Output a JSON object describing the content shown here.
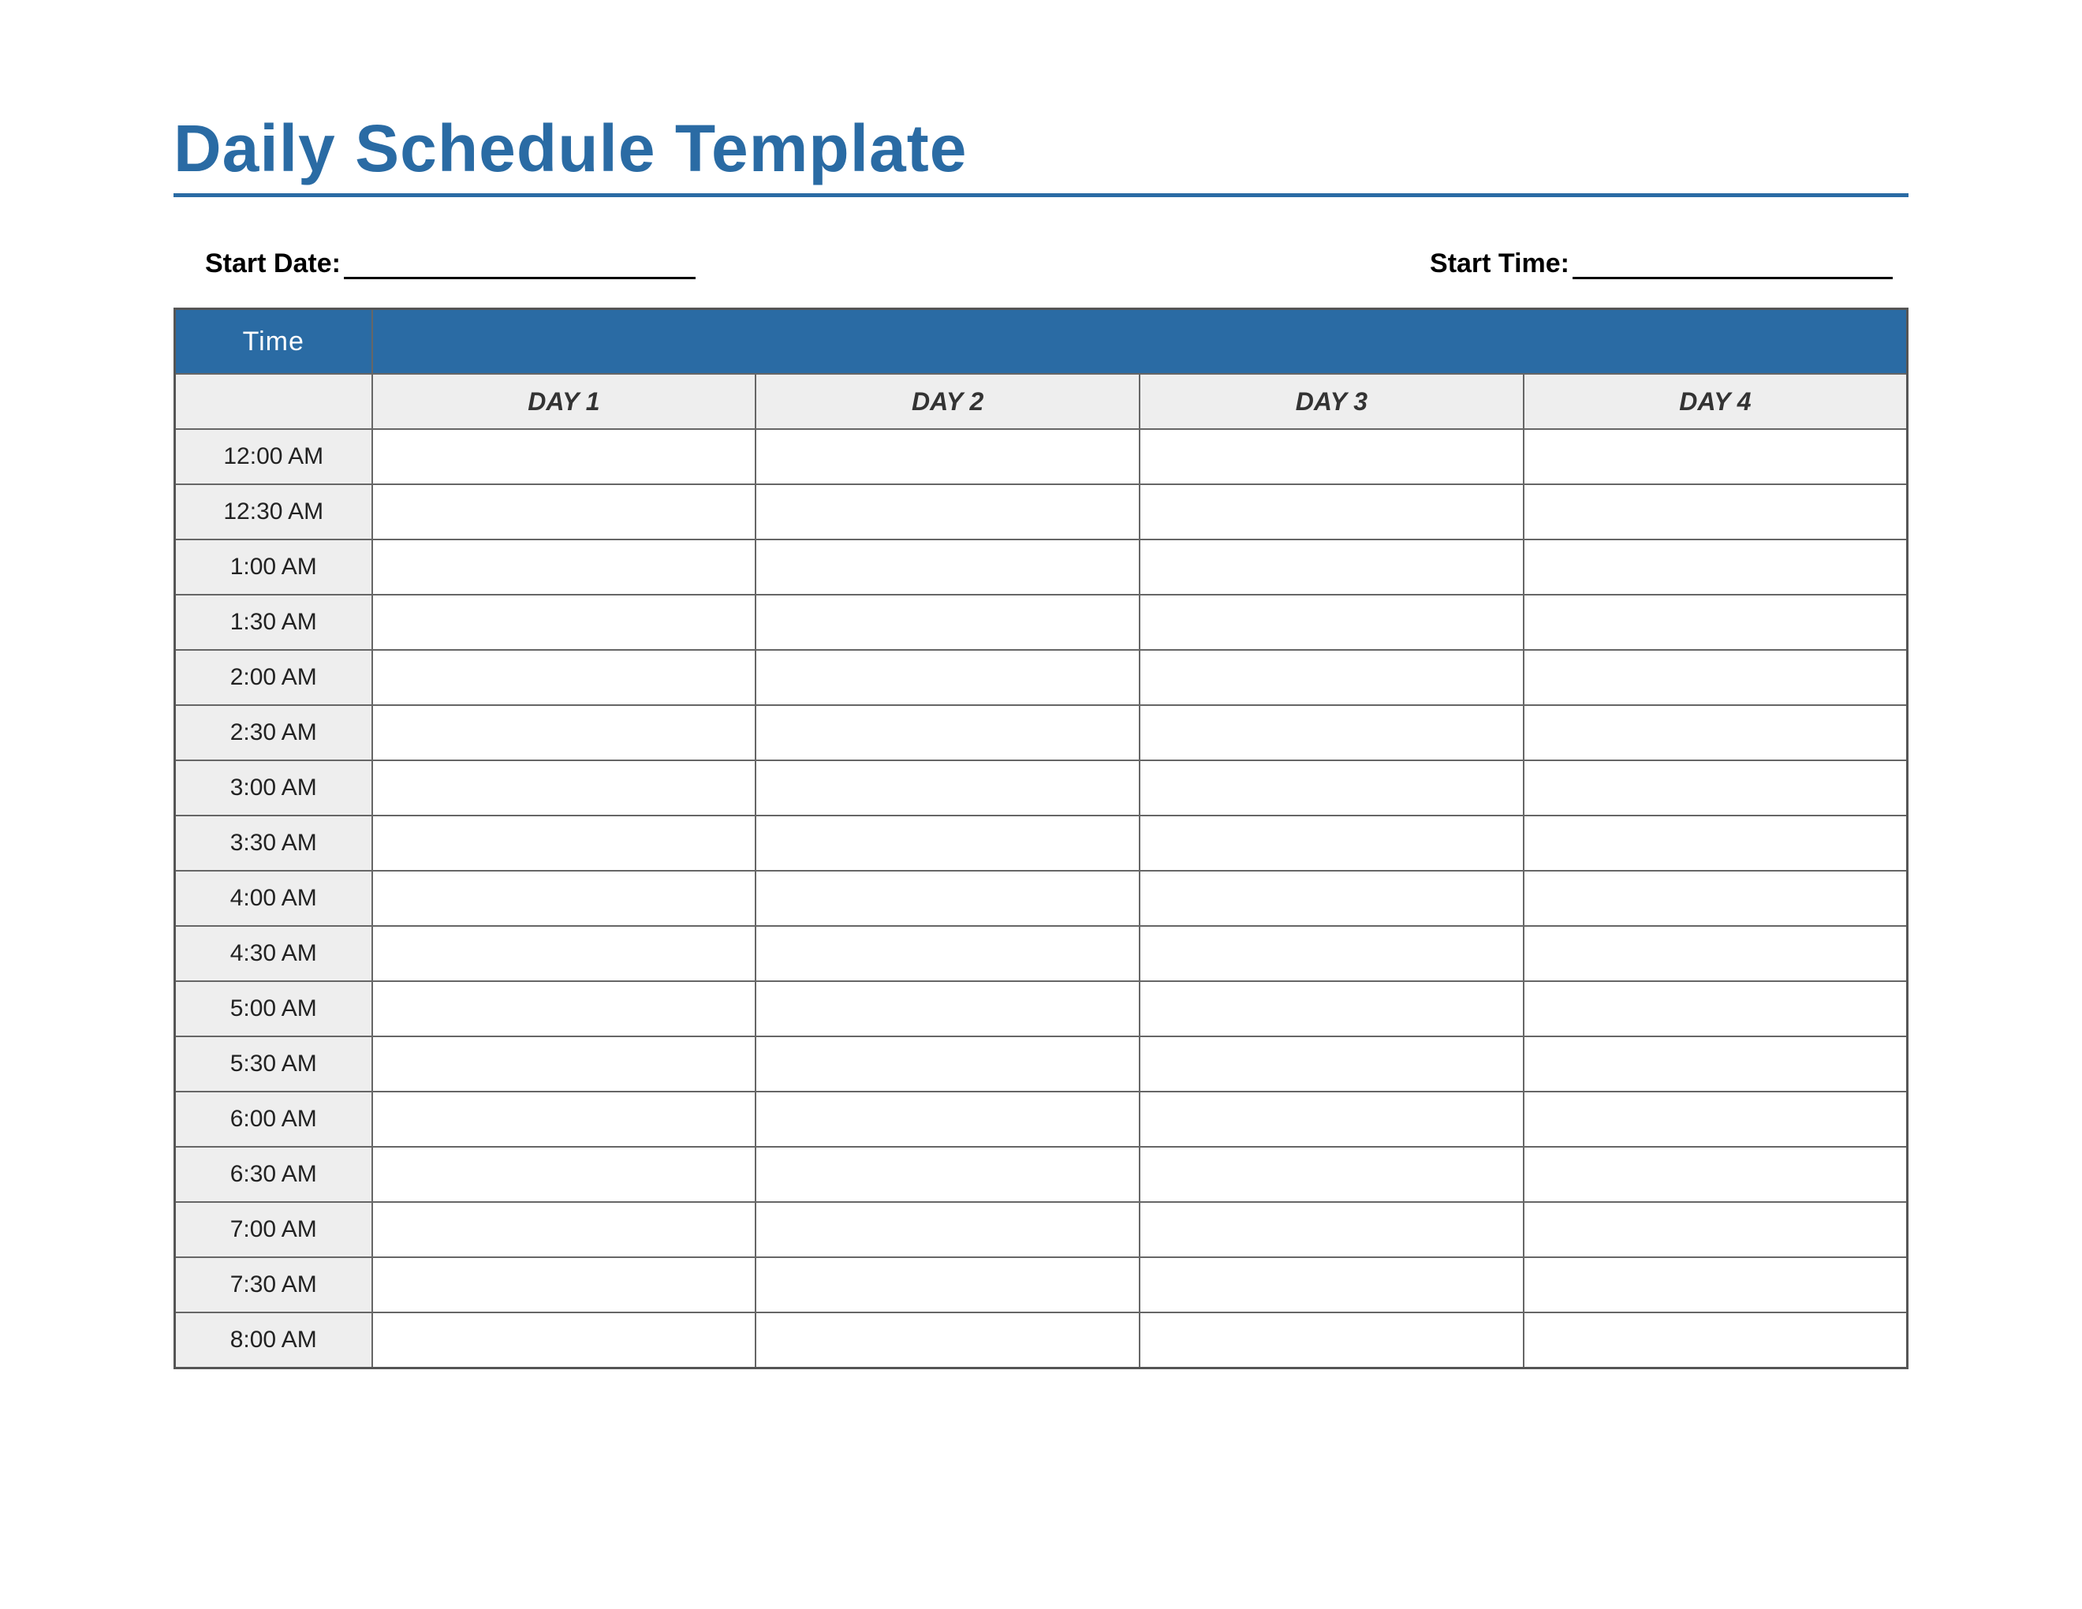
{
  "title": "Daily Schedule Template",
  "meta": {
    "start_date_label": "Start Date:",
    "start_date_value": "",
    "start_time_label": "Start Time:",
    "start_time_value": ""
  },
  "headers": {
    "time": "Time",
    "days": [
      "DAY 1",
      "DAY 2",
      "DAY 3",
      "DAY 4"
    ]
  },
  "times": [
    "12:00 AM",
    "12:30 AM",
    "1:00 AM",
    "1:30 AM",
    "2:00 AM",
    "2:30 AM",
    "3:00 AM",
    "3:30 AM",
    "4:00 AM",
    "4:30 AM",
    "5:00 AM",
    "5:30 AM",
    "6:00 AM",
    "6:30 AM",
    "7:00 AM",
    "7:30 AM",
    "8:00 AM"
  ],
  "colors": {
    "accent": "#2a6ba4",
    "grid_fill": "#eeeeee",
    "border": "#666666"
  }
}
